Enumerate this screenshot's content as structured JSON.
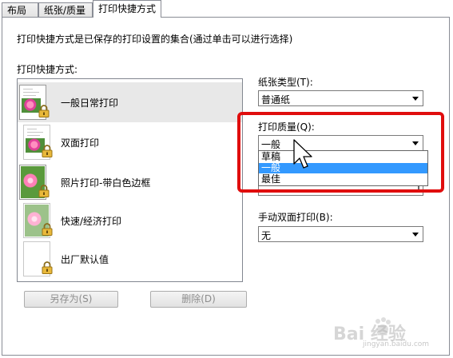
{
  "tabs": [
    {
      "label": "布局"
    },
    {
      "label": "纸张/质量"
    },
    {
      "label": "打印快捷方式"
    }
  ],
  "description": "打印快捷方式是已保存的打印设置的集合(通过单击可以进行选择)",
  "shortcuts": {
    "caption": "打印快捷方式:",
    "items": [
      {
        "label": "一般日常打印",
        "icon": "document-photo-icon",
        "locked": true
      },
      {
        "label": "双面打印",
        "icon": "duplex-document-icon",
        "locked": true
      },
      {
        "label": "照片打印-带白色边框",
        "icon": "photo-icon",
        "locked": true
      },
      {
        "label": "快速/经济打印",
        "icon": "photo-icon",
        "locked": true
      },
      {
        "label": "出厂默认值",
        "icon": "blank-page-icon",
        "locked": true
      }
    ],
    "save_as_label": "另存为(S)",
    "delete_label": "删除(D)"
  },
  "paper_type": {
    "label": "纸张类型(T):",
    "value": "普通纸"
  },
  "print_quality": {
    "label": "打印质量(Q):",
    "value": "一般",
    "options": [
      "草稿",
      "一般",
      "最佳"
    ],
    "highlighted": "一般",
    "underlying_value": "1"
  },
  "manual_duplex": {
    "label": "手动双面打印(B):",
    "value": "无"
  },
  "watermark": {
    "brand": "Bai 经验",
    "url": "jingyan.baidu.com"
  },
  "colors": {
    "highlight": "#3399ff",
    "annotation_box": "#e00d0d"
  }
}
